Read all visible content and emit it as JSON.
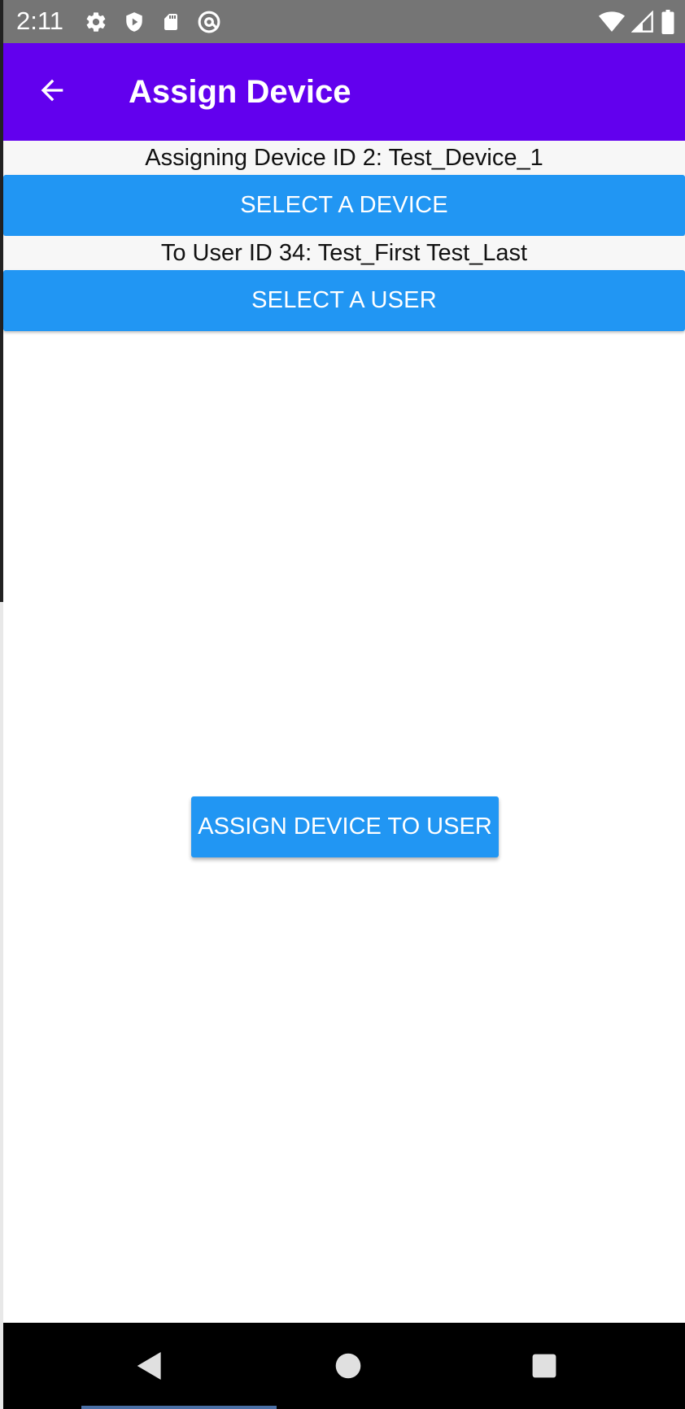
{
  "status_bar": {
    "time": "2:11",
    "left_icons": [
      "settings-icon",
      "shield-icon",
      "sd-card-icon",
      "at-sign-icon"
    ],
    "right_icons": [
      "wifi-icon",
      "signal-icon",
      "battery-icon"
    ]
  },
  "app_bar": {
    "title": "Assign Device",
    "back_icon": "arrow-left-icon",
    "color": "#6200ee"
  },
  "content": {
    "device_label": "Assigning Device ID 2: Test_Device_1",
    "select_device_button": "SELECT A DEVICE",
    "user_label": "To User ID 34: Test_First Test_Last",
    "select_user_button": "SELECT A USER",
    "assign_button": "ASSIGN DEVICE TO USER",
    "button_color": "#2196f3"
  },
  "nav_bar": {
    "icons": [
      "nav-back-icon",
      "nav-home-icon",
      "nav-recents-icon"
    ]
  }
}
